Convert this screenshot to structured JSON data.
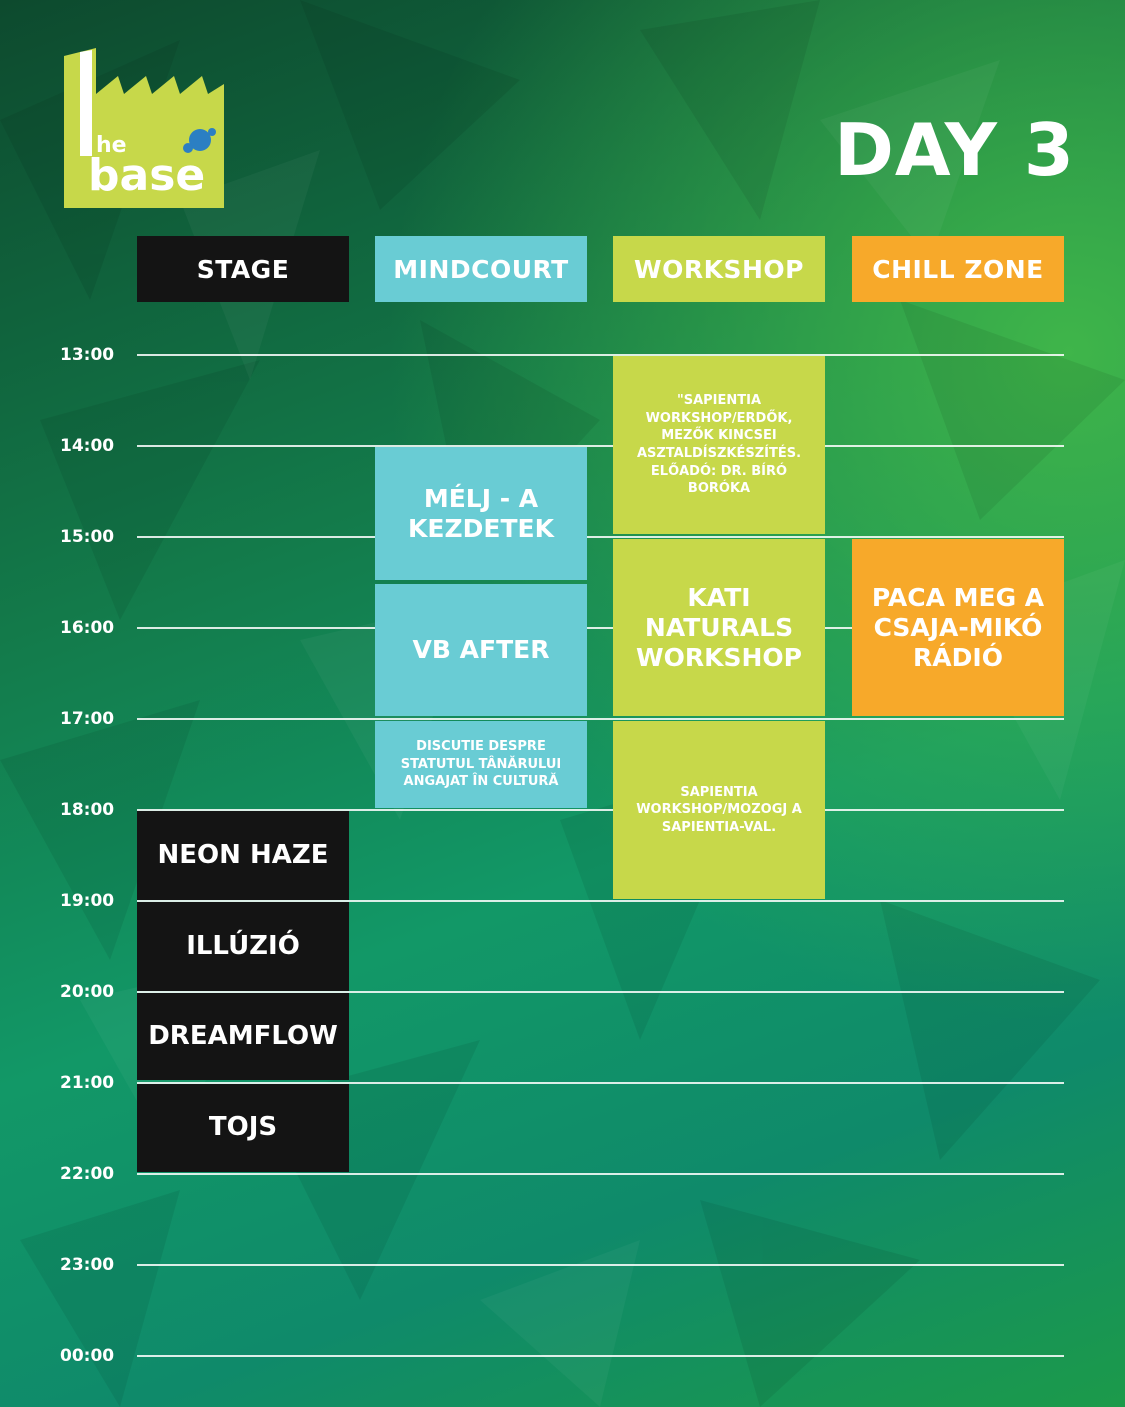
{
  "logo": {
    "line1": "he",
    "line2": "base",
    "color": "#c7d84a"
  },
  "day_title": "DAY 3",
  "columns": [
    {
      "label": "STAGE",
      "color": "#141414"
    },
    {
      "label": "MINDCOURT",
      "color": "#69ccd4"
    },
    {
      "label": "WORKSHOP",
      "color": "#c7d84a"
    },
    {
      "label": "CHILL ZONE",
      "color": "#f7a92a"
    }
  ],
  "times": [
    "13:00",
    "14:00",
    "15:00",
    "16:00",
    "17:00",
    "18:00",
    "19:00",
    "20:00",
    "21:00",
    "22:00",
    "23:00",
    "00:00"
  ],
  "events": {
    "stage": [
      "NEON HAZE",
      "ILLÚZIÓ",
      "DREAMFLOW",
      "TOJS"
    ],
    "mindcourt": [
      "MÉLJ - A KEZDETEK",
      "VB AFTER",
      "DISCUTIE DESPRE STATUTUL TÂNĂRULUI ANGAJAT ÎN CULTURĂ"
    ],
    "workshop": [
      "\"SAPIENTIA WORKSHOP/ERDŐK, MEZŐK KINCSEI ASZTALDÍSZKÉSZÍTÉS. ELŐADÓ: DR. BÍRÓ BORÓKA",
      "KATI NATURALS WORKSHOP",
      "SAPIENTIA WORKSHOP/MOZOGJ A SAPIENTIA-VAL."
    ],
    "chill": [
      "PACA MEG A CSAJA-MIKÓ RÁDIÓ"
    ]
  }
}
